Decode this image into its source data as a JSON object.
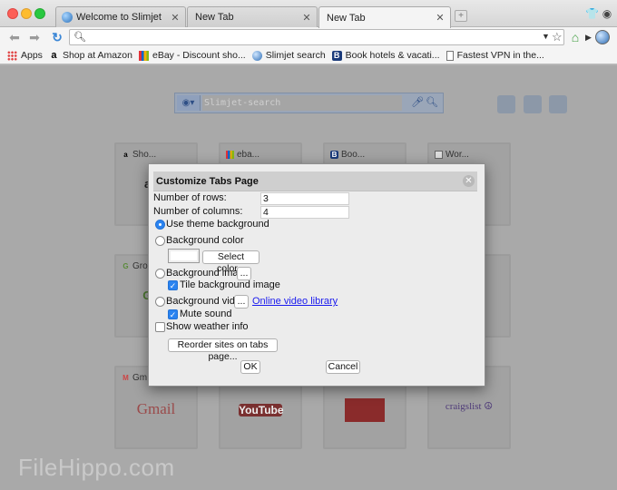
{
  "tabs": [
    {
      "label": "Welcome to Slimjet",
      "active": false
    },
    {
      "label": "New Tab",
      "active": false
    },
    {
      "label": "New Tab",
      "active": true
    }
  ],
  "bookmarks": [
    {
      "label": "Apps",
      "icon": "apps-grid-icon"
    },
    {
      "label": "Shop at Amazon",
      "icon": "amazon-icon"
    },
    {
      "label": "eBay - Discount sho...",
      "icon": "ebay-icon"
    },
    {
      "label": "Slimjet search",
      "icon": "globe-icon"
    },
    {
      "label": "Book hotels & vacati...",
      "icon": "booking-icon"
    },
    {
      "label": "Fastest VPN in the...",
      "icon": "page-icon"
    }
  ],
  "search": {
    "placeholder": "Slimjet-search"
  },
  "tiles": [
    {
      "label": "Sho...",
      "logo": "ama",
      "logo_color": "#222"
    },
    {
      "label": "eba...",
      "logo": "",
      "logo_color": "#222"
    },
    {
      "label": "Boo...",
      "logo": "",
      "logo_color": "#222"
    },
    {
      "label": "Wor...",
      "logo": "",
      "logo_color": "#222"
    },
    {
      "label": "Gro",
      "logo": "GRO",
      "logo_color": "#5a8a3a"
    },
    {
      "label": "Gm",
      "logo": "Gmail",
      "logo_color": "#c44"
    },
    {
      "label": "",
      "logo": "YouTube",
      "logo_color": "#fff"
    },
    {
      "label": "",
      "logo": "",
      "logo_color": "#b22"
    },
    {
      "label": "",
      "logo": "craigslist ☮",
      "logo_color": "#5b3f8a"
    }
  ],
  "dialog": {
    "title": "Customize Tabs Page",
    "rows_label": "Number of rows:",
    "rows_value": "3",
    "cols_label": "Number of columns:",
    "cols_value": "4",
    "opt_theme": "Use theme background",
    "opt_color": "Background color",
    "select_color_btn": "Select color...",
    "opt_image": "Background image",
    "browse_btn": "...",
    "tile_image": "Tile background image",
    "opt_video": "Background video",
    "video_library_link": "Online video library",
    "mute_sound": "Mute sound",
    "show_weather": "Show weather info",
    "reorder_btn": "Reorder sites on tabs page...",
    "ok_btn": "OK",
    "cancel_btn": "Cancel"
  },
  "watermark": "FileHippo.com",
  "colors": {
    "accent": "#2a83f0",
    "link": "#1a1aee"
  }
}
